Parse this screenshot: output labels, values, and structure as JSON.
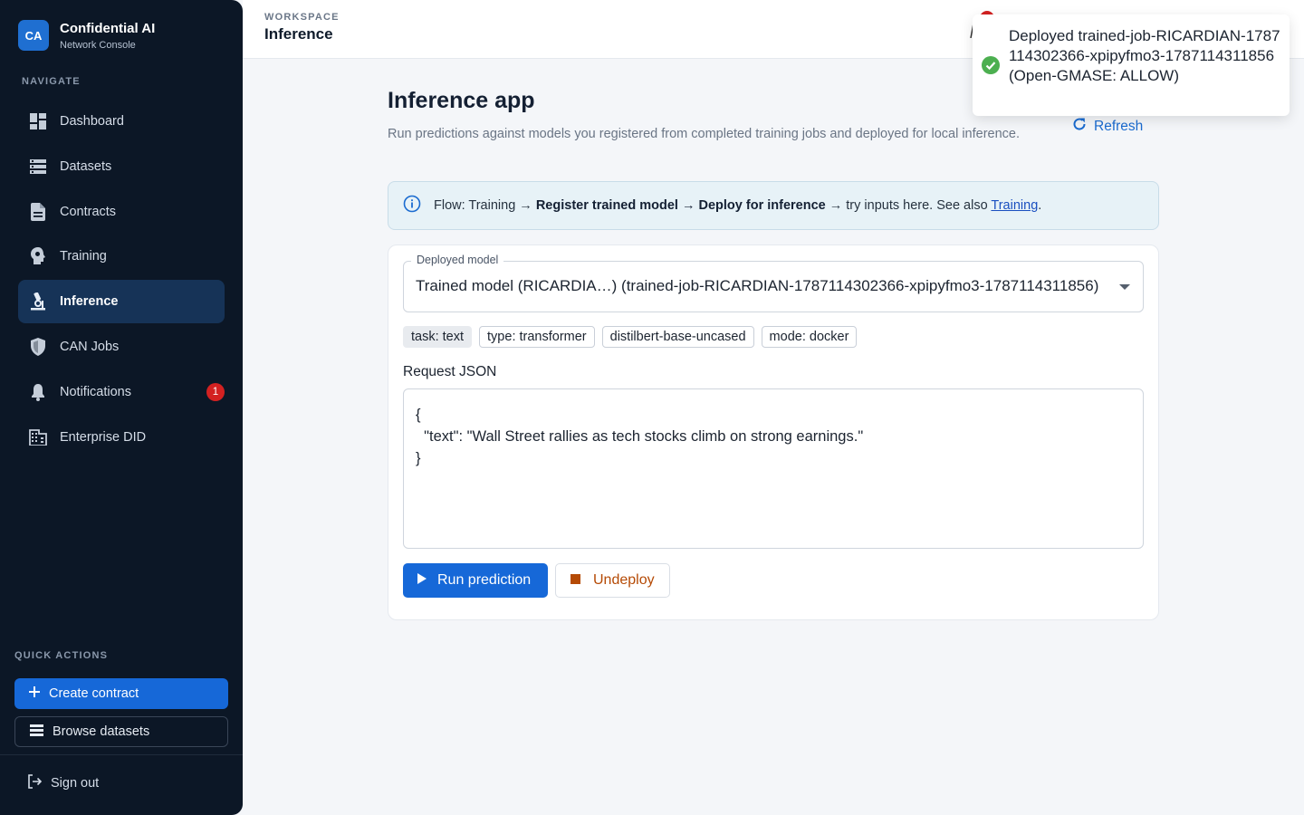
{
  "brand": {
    "logo": "CA",
    "title": "Confidential AI",
    "subtitle": "Network Console"
  },
  "sidebar": {
    "nav_heading": "NAVIGATE",
    "items": [
      {
        "label": "Dashboard",
        "icon": "dashboard-icon"
      },
      {
        "label": "Datasets",
        "icon": "datasets-icon"
      },
      {
        "label": "Contracts",
        "icon": "contracts-icon"
      },
      {
        "label": "Training",
        "icon": "training-icon"
      },
      {
        "label": "Inference",
        "icon": "inference-icon",
        "active": true
      },
      {
        "label": "CAN Jobs",
        "icon": "shield-icon"
      },
      {
        "label": "Notifications",
        "icon": "bell-icon",
        "badge": "1"
      },
      {
        "label": "Enterprise DID",
        "icon": "building-icon"
      }
    ],
    "quick_actions_heading": "QUICK ACTIONS",
    "create_contract": "Create contract",
    "browse_datasets": "Browse datasets",
    "sign_out": "Sign out"
  },
  "header": {
    "workspace_label": "WORKSPACE",
    "title": "Inference"
  },
  "main": {
    "title": "Inference app",
    "description": "Run predictions against models you registered from completed training jobs and deployed for local inference.",
    "refresh": "Refresh",
    "info": {
      "prefix": "Flow: Training → ",
      "step1": "Register trained model",
      "arrow1": " → ",
      "step2": "Deploy for inference",
      "suffix": " → try inputs here. See also ",
      "link": "Training",
      "end": "."
    },
    "model_select": {
      "legend": "Deployed model",
      "value": "Trained model (RICARDIA…) (trained-job-RICARDIAN-1787114302366-xpipyfmo3-1787114311856)"
    },
    "chips": [
      "task: text",
      "type: transformer",
      "distilbert-base-uncased",
      "mode: docker"
    ],
    "request_label": "Request JSON",
    "request_json": "{\n  \"text\": \"Wall Street rallies as tech stocks climb on strong earnings.\"\n}",
    "run_button": "Run prediction",
    "undeploy_button": "Undeploy"
  },
  "toast": {
    "message": "Deployed trained-job-RICARDIAN-1787114302366-xpipyfmo3-1787114311856 (Open-GMASE: ALLOW)"
  },
  "colors": {
    "sidebar_bg": "#0c1726",
    "accent": "#1668d8",
    "active_nav": "#163357",
    "danger": "#d32121",
    "success": "#4caf50",
    "warn_text": "#b54a05"
  }
}
